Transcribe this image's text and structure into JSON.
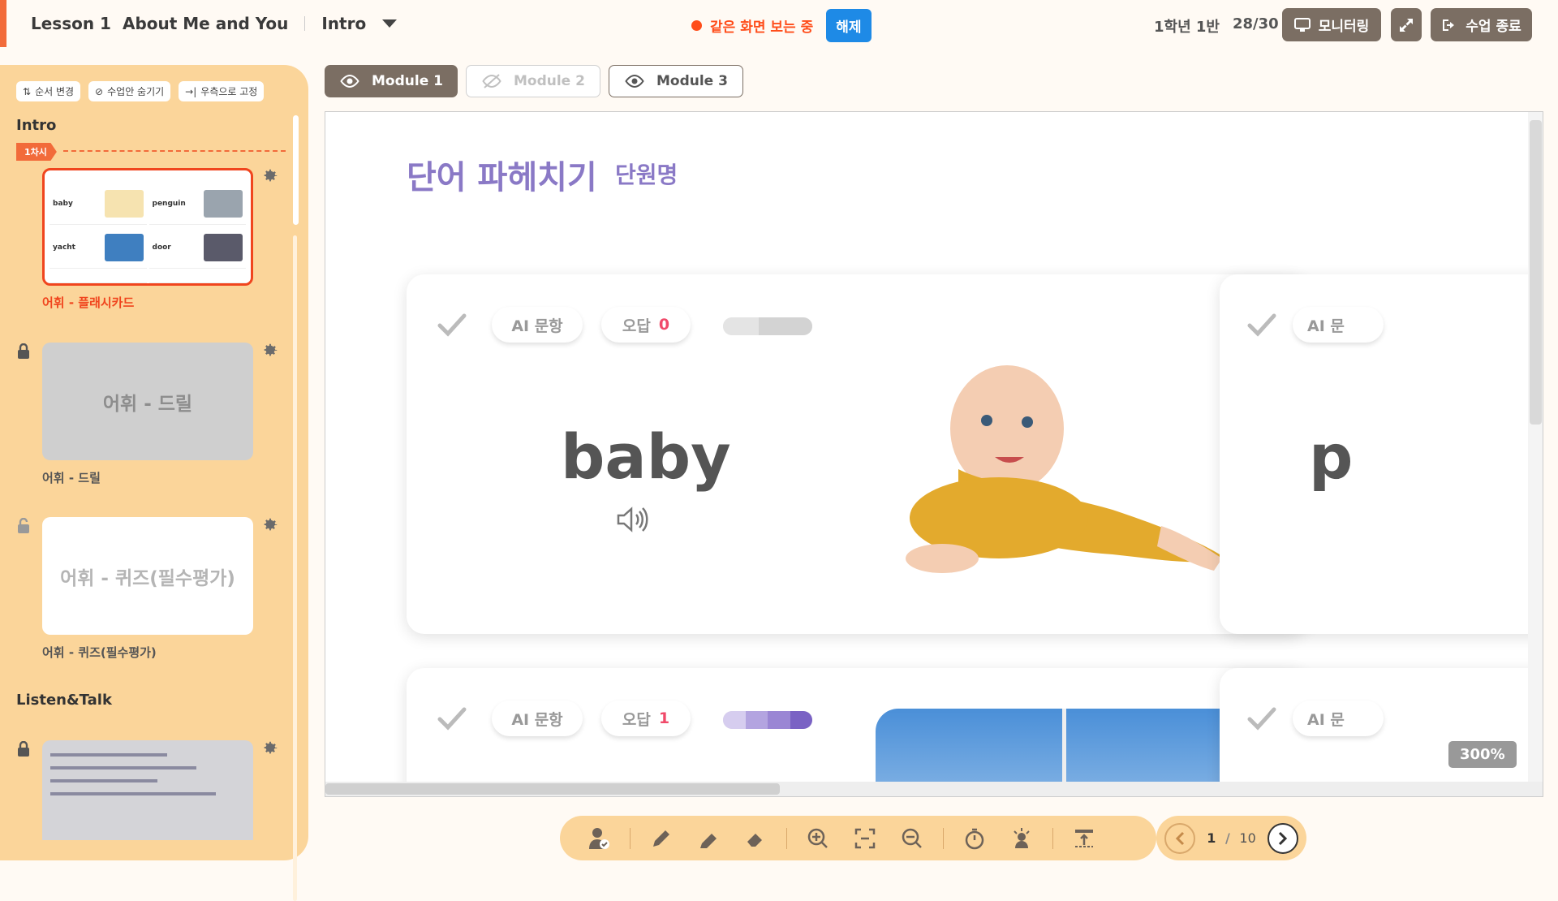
{
  "header": {
    "lesson": "Lesson 1",
    "lesson_title": "About Me and You",
    "section": "Intro",
    "share_status": "같은 화면 보는 중",
    "release_button": "해제",
    "class_name": "1학년 1반",
    "attendance": "28/30",
    "monitor_button": "모니터링",
    "end_button": "수업 종료"
  },
  "sidebar": {
    "tools": [
      "순서 변경",
      "수업안 숨기기",
      "우측으로 고정"
    ],
    "sections": [
      {
        "title": "Intro",
        "session_tag": "1차시"
      },
      {
        "title": "Listen&Talk"
      }
    ],
    "items": [
      {
        "label": "어휘 - 플래시카드",
        "card_text": "",
        "mini": [
          "baby",
          "penguin",
          "yacht",
          "door"
        ]
      },
      {
        "label": "어휘 - 드릴",
        "card_text": "어휘 - 드릴"
      },
      {
        "label": "어휘 - 퀴즈(필수평가)",
        "card_text": "어휘 - 퀴즈(필수평가)"
      }
    ]
  },
  "modules": [
    "Module 1",
    "Module 2",
    "Module 3"
  ],
  "viewer": {
    "title": "단어 파헤치기",
    "subtitle": "단원명",
    "cards": [
      {
        "ai_label": "AI 문항",
        "wrong_label": "오답",
        "wrong_count": "0",
        "word": "baby",
        "progress": 0.4
      },
      {
        "ai_label": "AI 문항",
        "wrong_label": "오답",
        "wrong_count": "1",
        "progress": 1.0
      }
    ],
    "side_ai_label": "AI 문",
    "side_word": "p",
    "zoom": "300%"
  },
  "pager": {
    "current": "1",
    "separator": "/",
    "total": "10"
  },
  "colors": {
    "accent": "#f26b3a",
    "sidebar": "#fbd59a",
    "title": "#8a79c6",
    "button_dark": "#7b6e63",
    "share": "#ff4d1a"
  }
}
